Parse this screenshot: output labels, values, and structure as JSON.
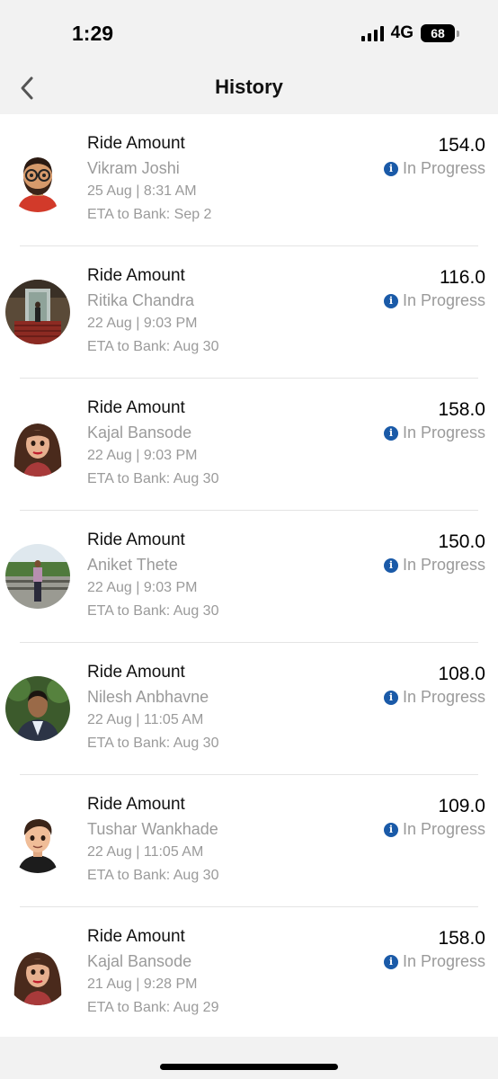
{
  "status_bar": {
    "time": "1:29",
    "network": "4G",
    "battery": "68"
  },
  "header": {
    "title": "History",
    "back_icon": "chevron-left-icon"
  },
  "colors": {
    "info_blue": "#1a5aa8",
    "muted_text": "#9a9a9a"
  },
  "history": [
    {
      "title": "Ride Amount",
      "name": "Vikram Joshi",
      "datetime": "25 Aug | 8:31 AM",
      "eta": "ETA to Bank: Sep 2",
      "amount": "154.0",
      "status": "In Progress",
      "avatar": "memoji-man-beard-glasses"
    },
    {
      "title": "Ride Amount",
      "name": "Ritika Chandra",
      "datetime": "22 Aug | 9:03 PM",
      "eta": "ETA to Bank: Aug 30",
      "amount": "116.0",
      "status": "In Progress",
      "avatar": "photo-doorway"
    },
    {
      "title": "Ride Amount",
      "name": "Kajal Bansode",
      "datetime": "22 Aug | 9:03 PM",
      "eta": "ETA to Bank: Aug 30",
      "amount": "158.0",
      "status": "In Progress",
      "avatar": "avatar-woman-red-lips"
    },
    {
      "title": "Ride Amount",
      "name": "Aniket Thete",
      "datetime": "22 Aug | 9:03 PM",
      "eta": "ETA to Bank: Aug 30",
      "amount": "150.0",
      "status": "In Progress",
      "avatar": "photo-man-park"
    },
    {
      "title": "Ride Amount",
      "name": "Nilesh Anbhavne",
      "datetime": "22 Aug | 11:05 AM",
      "eta": "ETA to Bank: Aug 30",
      "amount": "108.0",
      "status": "In Progress",
      "avatar": "photo-man-formal"
    },
    {
      "title": "Ride Amount",
      "name": "Tushar Wankhade",
      "datetime": "22 Aug | 11:05 AM",
      "eta": "ETA to Bank: Aug 30",
      "amount": "109.0",
      "status": "In Progress",
      "avatar": "avatar-man-cartoon"
    },
    {
      "title": "Ride Amount",
      "name": "Kajal Bansode",
      "datetime": "21 Aug | 9:28 PM",
      "eta": "ETA to Bank: Aug 29",
      "amount": "158.0",
      "status": "In Progress",
      "avatar": "avatar-woman-red-lips"
    }
  ]
}
